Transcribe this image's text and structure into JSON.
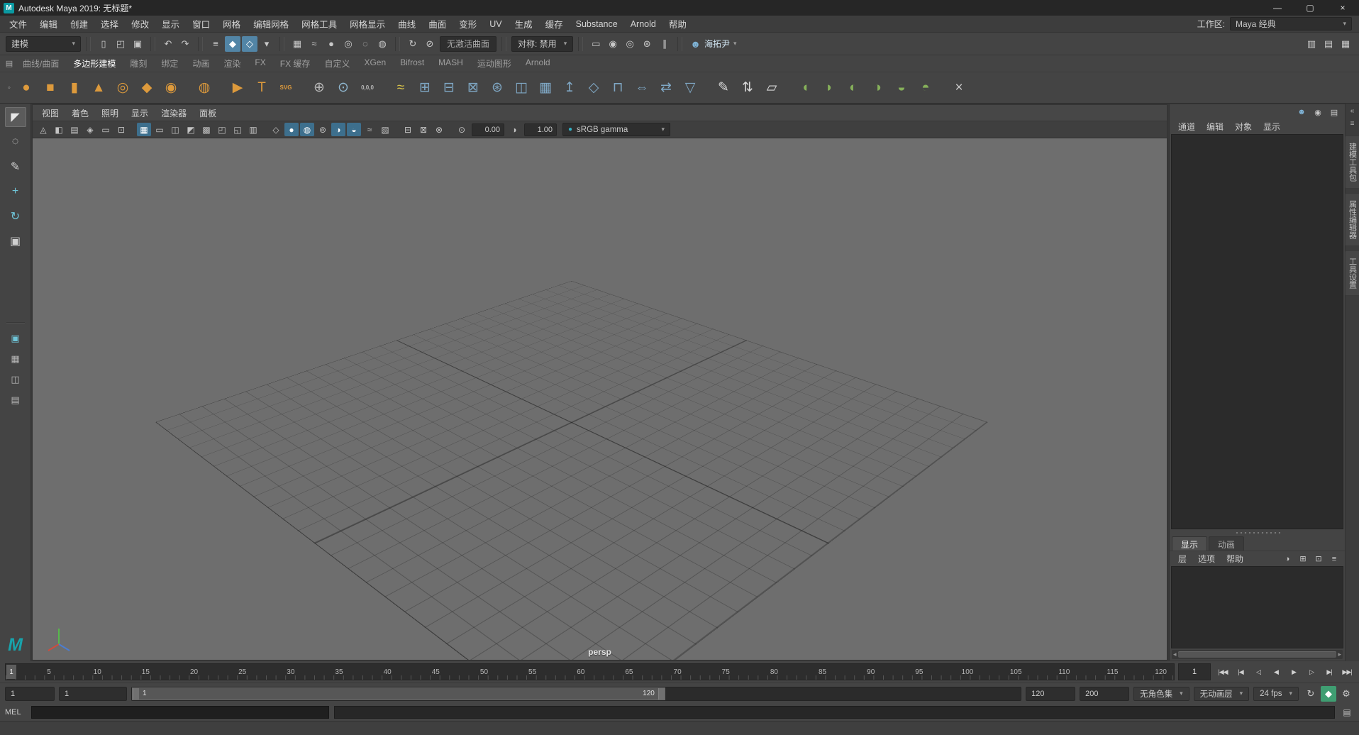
{
  "glyphs": {
    "down_arrow": "▾",
    "left_arrow": "◂",
    "right_arrow": "▸"
  },
  "colors": {
    "accent": "#5285a6",
    "viewport_bg": "#6e6e6e",
    "shelf_orange": "#dd9a3c",
    "shelf_blue": "#7fa7c4",
    "shelf_green": "#86b05a",
    "autokey_green": "#3f9e72",
    "maya_teal": "#18a3ab"
  },
  "window": {
    "app_icon": "M",
    "title": "Autodesk Maya 2019: 无标题*",
    "minimize": "—",
    "maximize": "▢",
    "close": "×"
  },
  "menu_bar": {
    "items": [
      "文件",
      "编辑",
      "创建",
      "选择",
      "修改",
      "显示",
      "窗口",
      "网格",
      "编辑网格",
      "网格工具",
      "网格显示",
      "曲线",
      "曲面",
      "变形",
      "UV",
      "生成",
      "缓存",
      "Substance",
      "Arnold",
      "帮助"
    ],
    "workspace_label": "工作区:",
    "workspace_value": "Maya 经典"
  },
  "status_line": {
    "menu_set": "建模",
    "file_icons": [
      {
        "name": "new-scene-icon",
        "glyph": "▯"
      },
      {
        "name": "open-scene-icon",
        "glyph": "◰"
      },
      {
        "name": "save-scene-icon",
        "glyph": "▣"
      }
    ],
    "undo_icons": [
      {
        "name": "undo-icon",
        "glyph": "↶"
      },
      {
        "name": "redo-icon",
        "glyph": "↷"
      }
    ],
    "selection_icons": [
      {
        "name": "select-by-hierarchy-icon",
        "glyph": "≡"
      },
      {
        "name": "select-by-object-icon",
        "glyph": "◆",
        "active": true
      },
      {
        "name": "select-by-component-icon",
        "glyph": "◇",
        "active": true
      },
      {
        "name": "selection-mask-icon",
        "glyph": "▾"
      }
    ],
    "snap_icons": [
      {
        "name": "snap-to-grid-icon",
        "glyph": "▦"
      },
      {
        "name": "snap-to-curve-icon",
        "glyph": "≈"
      },
      {
        "name": "snap-to-point-icon",
        "glyph": "●"
      },
      {
        "name": "snap-to-projected-center-icon",
        "glyph": "◎"
      },
      {
        "name": "snap-to-view-plane-icon",
        "glyph": "◌"
      },
      {
        "name": "make-live-icon",
        "glyph": "◍"
      }
    ],
    "history_icons": [
      {
        "name": "construction-history-icon",
        "glyph": "↻"
      },
      {
        "name": "no-construction-history-icon",
        "glyph": "⊘"
      }
    ],
    "live_surface": "无激活曲面",
    "symmetry": "对称: 禁用",
    "render_icons": [
      {
        "name": "render-view-icon",
        "glyph": "▭"
      },
      {
        "name": "render-current-frame-icon",
        "glyph": "◉"
      },
      {
        "name": "ipr-render-icon",
        "glyph": "◎"
      },
      {
        "name": "render-settings-icon",
        "glyph": "⊛"
      }
    ],
    "pause_glyph": "∥",
    "user": {
      "avatar_glyph": "☻",
      "name": "海拓尹"
    },
    "sidebar_icons": [
      {
        "name": "modeling-toolkit-toggle-icon",
        "glyph": "▥"
      },
      {
        "name": "attribute-editor-toggle-icon",
        "glyph": "▤"
      },
      {
        "name": "channel-box-toggle-icon",
        "glyph": "▦"
      }
    ]
  },
  "shelf": {
    "menu_icon": "▤",
    "item_icon": "◦",
    "tabs": [
      {
        "label": "曲线/曲面"
      },
      {
        "label": "多边形建模",
        "active": true
      },
      {
        "label": "雕刻"
      },
      {
        "label": "绑定"
      },
      {
        "label": "动画"
      },
      {
        "label": "渲染"
      },
      {
        "label": "FX"
      },
      {
        "label": "FX 缓存"
      },
      {
        "label": "自定义"
      },
      {
        "label": "XGen"
      },
      {
        "label": "Bifrost"
      },
      {
        "label": "MASH"
      },
      {
        "label": "运动图形"
      },
      {
        "label": "Arnold"
      }
    ],
    "icons": [
      {
        "name": "poly-sphere-icon",
        "glyph": "●",
        "color": "#dd9a3c"
      },
      {
        "name": "poly-cube-icon",
        "glyph": "■",
        "color": "#dd9a3c"
      },
      {
        "name": "poly-cylinder-icon",
        "glyph": "▮",
        "color": "#dd9a3c"
      },
      {
        "name": "poly-cone-icon",
        "glyph": "▲",
        "color": "#dd9a3c"
      },
      {
        "name": "poly-torus-icon",
        "glyph": "◎",
        "color": "#dd9a3c"
      },
      {
        "name": "poly-plane-icon",
        "glyph": "◆",
        "color": "#dd9a3c"
      },
      {
        "name": "poly-pipe-icon",
        "glyph": "◉",
        "color": "#dd9a3c"
      },
      {
        "name": "platonic-solid-icon",
        "glyph": "◍",
        "color": "#dd9a3c",
        "sep": true
      },
      {
        "name": "sweep-mesh-icon",
        "glyph": "▶",
        "color": "#dd9a3c",
        "sep": true
      },
      {
        "name": "type-text-icon",
        "glyph": "T",
        "color": "#dd9a3c"
      },
      {
        "name": "svg-tool-icon",
        "glyph": "SVG",
        "color": "#dd9a3c",
        "small": true
      },
      {
        "name": "focus-origin-icon",
        "glyph": "⊕",
        "color": "#b8b8b8",
        "sep": true
      },
      {
        "name": "snap-align-icon",
        "glyph": "⊙",
        "color": "#8fb7cf"
      },
      {
        "name": "zero-transform-icon",
        "glyph": "0,0,0",
        "color": "#b8b8b8",
        "small": true
      },
      {
        "name": "smooth-mesh-icon",
        "glyph": "≈",
        "color": "#d8c24a",
        "sep": true
      },
      {
        "name": "combine-icon",
        "glyph": "⊞",
        "color": "#7fa7c4"
      },
      {
        "name": "separate-icon",
        "glyph": "⊟",
        "color": "#7fa7c4"
      },
      {
        "name": "extract-icon",
        "glyph": "⊠",
        "color": "#7fa7c4"
      },
      {
        "name": "boolean-icon",
        "glyph": "⊛",
        "color": "#7fa7c4"
      },
      {
        "name": "mirror-icon",
        "glyph": "◫",
        "color": "#7fa7c4"
      },
      {
        "name": "subdivide-icon",
        "glyph": "▦",
        "color": "#7fa7c4"
      },
      {
        "name": "extrude-icon",
        "glyph": "↥",
        "color": "#7fa7c4"
      },
      {
        "name": "bevel-icon",
        "glyph": "◇",
        "color": "#7fa7c4"
      },
      {
        "name": "bridge-icon",
        "glyph": "⊓",
        "color": "#7fa7c4"
      },
      {
        "name": "symmetrize-icon",
        "glyph": "⇔",
        "color": "#7fa7c4"
      },
      {
        "name": "transfer-attributes-icon",
        "glyph": "⇄",
        "color": "#7fa7c4"
      },
      {
        "name": "reduce-icon",
        "glyph": "▽",
        "color": "#7fa7c4"
      },
      {
        "name": "multi-cut-icon",
        "glyph": "✎",
        "color": "#d8d8d8",
        "sep": true
      },
      {
        "name": "connect-icon",
        "glyph": "⇅",
        "color": "#d8d8d8"
      },
      {
        "name": "quad-draw-icon",
        "glyph": "▱",
        "color": "#d8d8d8"
      },
      {
        "name": "sculpt-brush-icon",
        "glyph": "◖",
        "color": "#86b05a",
        "sep": true
      },
      {
        "name": "smooth-brush-icon",
        "glyph": "◗",
        "color": "#86b05a"
      },
      {
        "name": "bulge-brush-icon",
        "glyph": "◐",
        "color": "#86b05a"
      },
      {
        "name": "grab-brush-icon",
        "glyph": "◑",
        "color": "#86b05a"
      },
      {
        "name": "pinch-brush-icon",
        "glyph": "◒",
        "color": "#86b05a"
      },
      {
        "name": "relax-brush-icon",
        "glyph": "◓",
        "color": "#86b05a"
      },
      {
        "name": "cleanup-icon",
        "glyph": "×",
        "color": "#c8c8c8",
        "sep": true
      }
    ]
  },
  "tool_box": {
    "logo": "M",
    "tools": [
      {
        "name": "select-tool",
        "glyph": "◤",
        "color": "#e8e8e8",
        "active": true
      },
      {
        "name": "lasso-tool",
        "glyph": "◌",
        "color": "#d0d0d0"
      },
      {
        "name": "paint-select-tool",
        "glyph": "✎",
        "color": "#d0d0d0"
      },
      {
        "name": "move-tool",
        "glyph": "+",
        "color": "#6fc5d8"
      },
      {
        "name": "rotate-tool",
        "glyph": "↻",
        "color": "#6fc5d8"
      },
      {
        "name": "scale-tool",
        "glyph": "▣",
        "color": "#d0d0d0"
      }
    ],
    "layouts": [
      {
        "name": "single-pane-layout-icon",
        "glyph": "▣",
        "color": "#6fc5d8"
      },
      {
        "name": "four-pane-layout-icon",
        "glyph": "▦",
        "color": "#b5b5b5"
      },
      {
        "name": "two-pane-layout-icon",
        "glyph": "◫",
        "color": "#b5b5b5"
      },
      {
        "name": "outliner-pane-layout-icon",
        "glyph": "▤",
        "color": "#b5b5b5"
      }
    ]
  },
  "viewport": {
    "menus": [
      "视图",
      "着色",
      "照明",
      "显示",
      "渲染器",
      "面板"
    ],
    "icons": [
      {
        "name": "select-camera-icon",
        "glyph": "◬"
      },
      {
        "name": "lock-camera-icon",
        "glyph": "◧"
      },
      {
        "name": "camera-attributes-icon",
        "glyph": "▤"
      },
      {
        "name": "bookmarks-icon",
        "glyph": "◈"
      },
      {
        "name": "image-plane-icon",
        "glyph": "▭"
      },
      {
        "name": "pan-zoom-icon",
        "glyph": "⊡"
      },
      {
        "name": "grid-toggle-icon",
        "glyph": "▦",
        "active": true,
        "sep": true
      },
      {
        "name": "film-gate-icon",
        "glyph": "▭"
      },
      {
        "name": "resolution-gate-icon",
        "glyph": "◫"
      },
      {
        "name": "gate-mask-icon",
        "glyph": "◩"
      },
      {
        "name": "field-chart-icon",
        "glyph": "▩"
      },
      {
        "name": "safe-action-icon",
        "glyph": "◰"
      },
      {
        "name": "safe-title-icon",
        "glyph": "◱"
      },
      {
        "name": "hud-toggle-icon",
        "glyph": "▥"
      },
      {
        "name": "wireframe-display-icon",
        "glyph": "◇",
        "sep": true
      },
      {
        "name": "shaded-display-icon",
        "glyph": "●",
        "active": true
      },
      {
        "name": "textured-display-icon",
        "glyph": "◍",
        "active": true
      },
      {
        "name": "lights-toggle-icon",
        "glyph": "⊚"
      },
      {
        "name": "shadows-toggle-icon",
        "glyph": "◑",
        "active": true
      },
      {
        "name": "ambient-occlusion-icon",
        "glyph": "◒",
        "active": true
      },
      {
        "name": "motion-blur-icon",
        "glyph": "≈"
      },
      {
        "name": "anti-aliasing-icon",
        "glyph": "▧"
      },
      {
        "name": "isolate-select-icon",
        "glyph": "⊟",
        "sep": true
      },
      {
        "name": "xray-icon",
        "glyph": "⊠"
      },
      {
        "name": "xray-joints-icon",
        "glyph": "⊗"
      }
    ],
    "exposure_icon": "⊙",
    "exposure": "0.00",
    "gamma_icon": "◑",
    "gamma": "1.00",
    "colorspace_icon": "●",
    "colorspace": "sRGB gamma",
    "camera_label": "persp"
  },
  "channel_box": {
    "corner_icons": [
      {
        "name": "person-icon",
        "glyph": "☻",
        "color": "#7fb3d6"
      },
      {
        "name": "camera-icon",
        "glyph": "◉",
        "color": "#c8c8c8"
      },
      {
        "name": "notes-icon",
        "glyph": "▤",
        "color": "#c8c8c8"
      }
    ],
    "menus": [
      "通道",
      "编辑",
      "对象",
      "显示"
    ]
  },
  "layer_editor": {
    "tabs": [
      {
        "label": "显示",
        "active": true
      },
      {
        "label": "动画"
      }
    ],
    "menus": [
      "层",
      "选项",
      "帮助"
    ],
    "icons": [
      {
        "name": "layer-visibility-icon",
        "glyph": "◑"
      },
      {
        "name": "new-empty-layer-icon",
        "glyph": "⊞"
      },
      {
        "name": "new-layer-from-selected-icon",
        "glyph": "⊡"
      },
      {
        "name": "layer-options-icon",
        "glyph": "≡"
      }
    ]
  },
  "right_strip": {
    "top_icons": [
      {
        "name": "expand-panel-icon",
        "glyph": "«"
      },
      {
        "name": "panel-menu-icon",
        "glyph": "≡"
      }
    ],
    "tabs": [
      {
        "label": "建模工具包"
      },
      {
        "label": "属性编辑器"
      },
      {
        "label": "工具设置"
      }
    ]
  },
  "timeline": {
    "playhead": "1",
    "tick_labels": [
      "5",
      "10",
      "15",
      "20",
      "25",
      "30",
      "35",
      "40",
      "45",
      "50",
      "55",
      "60",
      "65",
      "70",
      "75",
      "80",
      "85",
      "90",
      "95",
      "100",
      "105",
      "110",
      "115",
      "120"
    ],
    "current_time": "1",
    "buttons": [
      {
        "name": "go-to-start-button",
        "glyph": "|◀◀"
      },
      {
        "name": "step-back-frame-button",
        "glyph": "|◀"
      },
      {
        "name": "step-back-key-button",
        "glyph": "◁"
      },
      {
        "name": "play-backwards-button",
        "glyph": "◀"
      },
      {
        "name": "play-forwards-button",
        "glyph": "▶"
      },
      {
        "name": "step-forward-key-button",
        "glyph": "▷"
      },
      {
        "name": "step-forward-frame-button",
        "glyph": "▶|"
      },
      {
        "name": "go-to-end-button",
        "glyph": "▶▶|"
      }
    ]
  },
  "range_slider": {
    "anim_start": "1",
    "playback_start": "1",
    "bar_start": "1",
    "bar_end": "120",
    "bar_width": "60%",
    "playback_end": "120",
    "anim_end": "200",
    "character_set": "无角色集",
    "anim_layer": "无动画层",
    "fps": "24 fps",
    "icons": [
      {
        "name": "playback-loop-icon",
        "glyph": "↻"
      },
      {
        "name": "auto-key-button",
        "glyph": "◆",
        "active": true
      },
      {
        "name": "animation-preferences-gear-icon",
        "glyph": "⚙"
      }
    ]
  },
  "command_line": {
    "label": "MEL",
    "value": "",
    "icon_glyph": "▤"
  },
  "help_line": {
    "text": ""
  }
}
